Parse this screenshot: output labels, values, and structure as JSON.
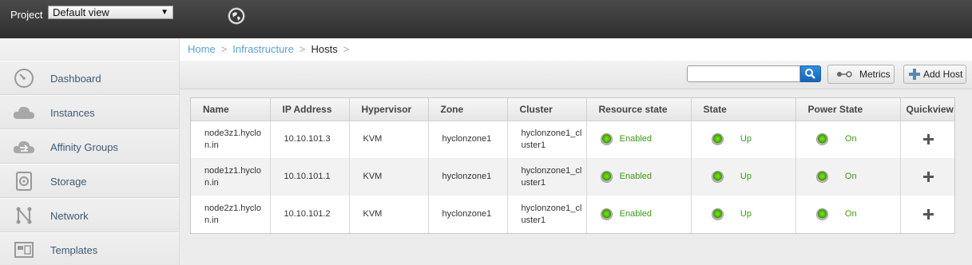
{
  "header": {
    "project_label": "Project",
    "project_selected": "Default view"
  },
  "sidebar": {
    "items": [
      {
        "label": "Dashboard",
        "icon": "dashboard-icon"
      },
      {
        "label": "Instances",
        "icon": "cloud-icon"
      },
      {
        "label": "Affinity Groups",
        "icon": "affinity-icon"
      },
      {
        "label": "Storage",
        "icon": "storage-icon"
      },
      {
        "label": "Network",
        "icon": "network-icon"
      },
      {
        "label": "Templates",
        "icon": "templates-icon"
      }
    ]
  },
  "breadcrumb": {
    "home": "Home",
    "infrastructure": "Infrastructure",
    "current": "Hosts",
    "sep": ">"
  },
  "toolbar": {
    "search_value": "",
    "metrics_label": "Metrics",
    "add_host_label": "Add Host"
  },
  "table": {
    "columns": [
      "Name",
      "IP Address",
      "Hypervisor",
      "Zone",
      "Cluster",
      "Resource state",
      "State",
      "Power State",
      "Quickview"
    ],
    "rows": [
      {
        "name": "node3z1.hyclon.in",
        "ip": "10.10.101.3",
        "hypervisor": "KVM",
        "zone": "hyclonzone1",
        "cluster": "hyclonzone1_cluster1",
        "resource_state": "Enabled",
        "state": "Up",
        "power_state": "On"
      },
      {
        "name": "node1z1.hyclon.in",
        "ip": "10.10.101.1",
        "hypervisor": "KVM",
        "zone": "hyclonzone1",
        "cluster": "hyclonzone1_cluster1",
        "resource_state": "Enabled",
        "state": "Up",
        "power_state": "On"
      },
      {
        "name": "node2z1.hyclon.in",
        "ip": "10.10.101.2",
        "hypervisor": "KVM",
        "zone": "hyclonzone1",
        "cluster": "hyclonzone1_cluster1",
        "resource_state": "Enabled",
        "state": "Up",
        "power_state": "On"
      }
    ]
  },
  "colors": {
    "link": "#5ba0d6",
    "status_ok": "#3a9b12",
    "header_bg": "#3a3a3a"
  }
}
